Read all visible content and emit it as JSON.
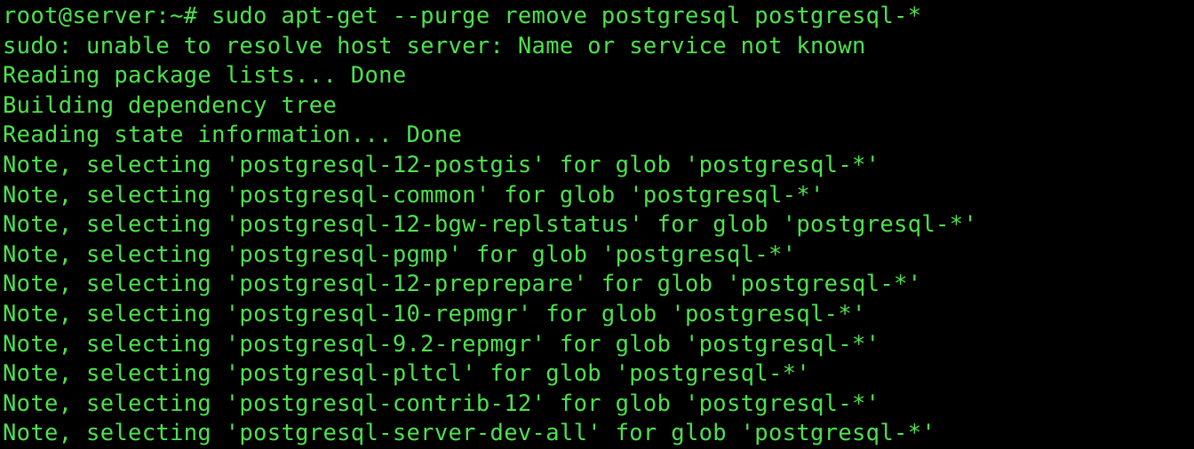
{
  "terminal": {
    "background_color": "#000000",
    "foreground_color": "#4ee24e",
    "prompt": "root@server:~#",
    "command": "sudo apt-get --purge remove postgresql postgresql-*",
    "rows": 15,
    "columns": 69,
    "lines": [
      "root@server:~# sudo apt-get --purge remove postgresql postgresql-*",
      "sudo: unable to resolve host server: Name or service not known",
      "Reading package lists... Done",
      "Building dependency tree",
      "Reading state information... Done",
      "Note, selecting 'postgresql-12-postgis' for glob 'postgresql-*'",
      "Note, selecting 'postgresql-common' for glob 'postgresql-*'",
      "Note, selecting 'postgresql-12-bgw-replstatus' for glob 'postgresql-*'",
      "Note, selecting 'postgresql-pgmp' for glob 'postgresql-*'",
      "Note, selecting 'postgresql-12-preprepare' for glob 'postgresql-*'",
      "Note, selecting 'postgresql-10-repmgr' for glob 'postgresql-*'",
      "Note, selecting 'postgresql-9.2-repmgr' for glob 'postgresql-*'",
      "Note, selecting 'postgresql-pltcl' for glob 'postgresql-*'",
      "Note, selecting 'postgresql-contrib-12' for glob 'postgresql-*'",
      "Note, selecting 'postgresql-server-dev-all' for glob 'postgresql-*'"
    ],
    "selected_packages": [
      "postgresql-12-postgis",
      "postgresql-common",
      "postgresql-12-bgw-replstatus",
      "postgresql-pgmp",
      "postgresql-12-preprepare",
      "postgresql-10-repmgr",
      "postgresql-9.2-repmgr",
      "postgresql-pltcl",
      "postgresql-contrib-12",
      "postgresql-server-dev-all"
    ],
    "glob_pattern": "postgresql-*",
    "warning": "sudo: unable to resolve host server: Name or service not known"
  }
}
